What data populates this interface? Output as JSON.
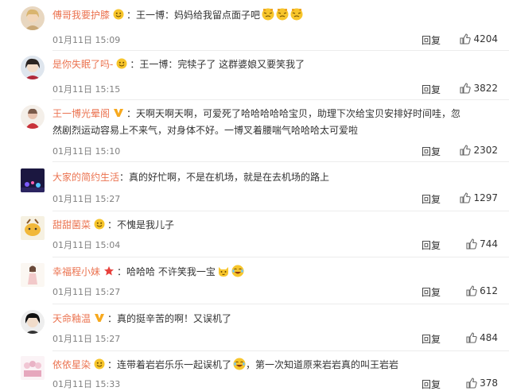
{
  "comments": [
    {
      "user": "傅哥我要护膝",
      "text": "：王一博：妈妈给我留点面子吧",
      "time": "01月11日 15:09",
      "reply": "回复",
      "likes": "4204",
      "badge": "emoji",
      "avatar": "girl-blonde"
    },
    {
      "user": "是你失眠了吗-",
      "text": "：王一博：完犊子了 这群婆娘又要笑我了",
      "time": "01月11日 15:15",
      "reply": "回复",
      "likes": "3822",
      "badge": "emoji",
      "avatar": "girl-dark"
    },
    {
      "user": "王一博光晕阁",
      "text": "：天啊天啊天啊，可爱死了哈哈哈哈哈宝贝，助理下次给宝贝安排好时间哇，忽然剧烈运动容易上不来气，对身体不好。一博叉着腰喘气哈哈哈太可爱啦",
      "time": "01月11日 15:10",
      "reply": "回复",
      "likes": "2302",
      "badge": "vip-v",
      "avatar": "red-figure"
    },
    {
      "user": "大家的简约生活",
      "text": "：真的好忙啊，不是在机场，就是在去机场的路上",
      "time": "01月11日 15:27",
      "reply": "回复",
      "likes": "1297",
      "badge": "",
      "avatar": "night-lights"
    },
    {
      "user": "甜甜菌菜",
      "text": "：不愧是我儿子",
      "time": "01月11日 15:04",
      "reply": "回复",
      "likes": "744",
      "badge": "emoji",
      "avatar": "yellow-cartoon"
    },
    {
      "user": "幸福程小妹",
      "text": "：哈哈哈 不许笑我一宝",
      "time": "01月11日 15:27",
      "reply": "回复",
      "likes": "612",
      "badge": "star",
      "avatar": "standing-girl"
    },
    {
      "user": "天命釉温",
      "text": "：真的挺辛苦的啊！又误机了",
      "time": "01月11日 15:27",
      "reply": "回复",
      "likes": "484",
      "badge": "vip-v",
      "avatar": "black-hair"
    },
    {
      "user": "依依星染",
      "text": "：连带着岩岩乐乐一起误机了",
      "text2": "，第一次知道原来岩岩真的叫王岩岩",
      "time": "01月11日 15:33",
      "reply": "回复",
      "likes": "378",
      "badge": "emoji",
      "avatar": "pink-group"
    }
  ],
  "colors": {
    "username": "#eb7350",
    "meta": "#808080",
    "text": "#333333",
    "divider": "#ececec"
  },
  "icons": {
    "like": "thumbs-up-icon",
    "emoji": "smiley-icon",
    "vip": "v-badge-icon",
    "star": "star-badge-icon"
  }
}
